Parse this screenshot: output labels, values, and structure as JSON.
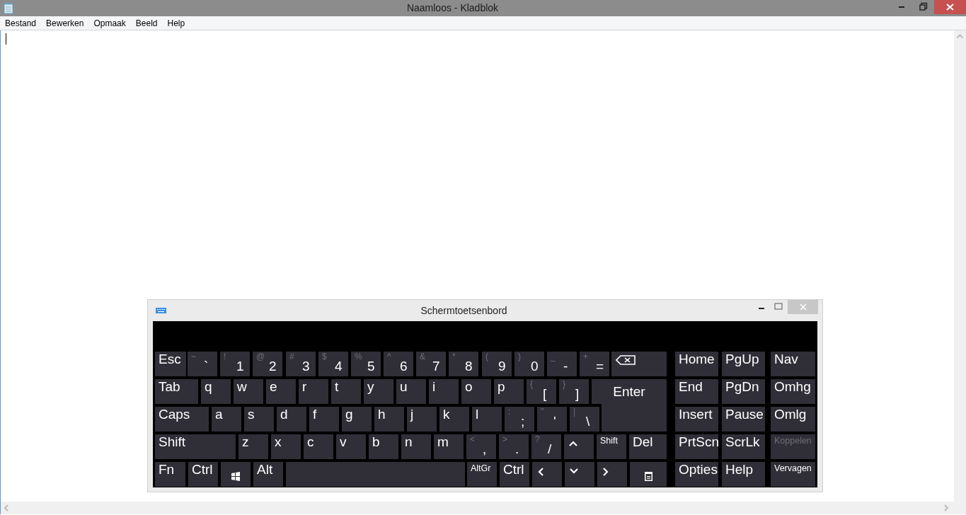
{
  "notepad": {
    "title": "Naamloos - Kladblok",
    "menu": [
      "Bestand",
      "Bewerken",
      "Opmaak",
      "Beeld",
      "Help"
    ]
  },
  "keyboard": {
    "title": "Schermtoetsenbord",
    "main_rows": [
      [
        {
          "kind": "text",
          "label": "Esc"
        },
        {
          "kind": "dual",
          "shift": "~",
          "label": "`"
        },
        {
          "kind": "dual",
          "shift": "!",
          "label": "1"
        },
        {
          "kind": "dual",
          "shift": "@",
          "label": "2"
        },
        {
          "kind": "dual",
          "shift": "#",
          "label": "3"
        },
        {
          "kind": "dual",
          "shift": "$",
          "label": "4"
        },
        {
          "kind": "dual",
          "shift": "%",
          "label": "5"
        },
        {
          "kind": "dual",
          "shift": "^",
          "label": "6"
        },
        {
          "kind": "dual",
          "shift": "&",
          "label": "7"
        },
        {
          "kind": "dual",
          "shift": "*",
          "label": "8"
        },
        {
          "kind": "dual",
          "shift": "(",
          "label": "9"
        },
        {
          "kind": "dual",
          "shift": ")",
          "label": "0"
        },
        {
          "kind": "dual",
          "shift": "_",
          "label": "-"
        },
        {
          "kind": "dual",
          "shift": "+",
          "label": "="
        },
        {
          "kind": "backspace"
        }
      ],
      [
        {
          "kind": "text",
          "label": "Tab"
        },
        {
          "kind": "text",
          "label": "q"
        },
        {
          "kind": "text",
          "label": "w"
        },
        {
          "kind": "text",
          "label": "e"
        },
        {
          "kind": "text",
          "label": "r"
        },
        {
          "kind": "text",
          "label": "t"
        },
        {
          "kind": "text",
          "label": "y"
        },
        {
          "kind": "text",
          "label": "u"
        },
        {
          "kind": "text",
          "label": "i"
        },
        {
          "kind": "text",
          "label": "o"
        },
        {
          "kind": "text",
          "label": "p"
        },
        {
          "kind": "dual",
          "shift": "{",
          "label": "["
        },
        {
          "kind": "dual",
          "shift": "}",
          "label": "]"
        },
        {
          "kind": "enter",
          "label": "Enter"
        }
      ],
      [
        {
          "kind": "text",
          "label": "Caps"
        },
        {
          "kind": "text",
          "label": "a"
        },
        {
          "kind": "text",
          "label": "s"
        },
        {
          "kind": "text",
          "label": "d"
        },
        {
          "kind": "text",
          "label": "f"
        },
        {
          "kind": "text",
          "label": "g"
        },
        {
          "kind": "text",
          "label": "h"
        },
        {
          "kind": "text",
          "label": "j"
        },
        {
          "kind": "text",
          "label": "k"
        },
        {
          "kind": "text",
          "label": "l"
        },
        {
          "kind": "dual",
          "shift": ":",
          "label": ";"
        },
        {
          "kind": "dual",
          "shift": "\"",
          "label": "'"
        },
        {
          "kind": "dual",
          "shift": "|",
          "label": "\\"
        }
      ],
      [
        {
          "kind": "text",
          "label": "Shift"
        },
        {
          "kind": "text",
          "label": "z"
        },
        {
          "kind": "text",
          "label": "x"
        },
        {
          "kind": "text",
          "label": "c"
        },
        {
          "kind": "text",
          "label": "v"
        },
        {
          "kind": "text",
          "label": "b"
        },
        {
          "kind": "text",
          "label": "n"
        },
        {
          "kind": "text",
          "label": "m"
        },
        {
          "kind": "dual",
          "shift": "<",
          "label": ","
        },
        {
          "kind": "dual",
          "shift": ">",
          "label": "."
        },
        {
          "kind": "dual",
          "shift": "?",
          "label": "/"
        },
        {
          "kind": "up"
        },
        {
          "kind": "small",
          "label": "Shift"
        },
        {
          "kind": "text",
          "label": "Del"
        }
      ],
      [
        {
          "kind": "text",
          "label": "Fn"
        },
        {
          "kind": "text",
          "label": "Ctrl"
        },
        {
          "kind": "windows"
        },
        {
          "kind": "text",
          "label": "Alt"
        },
        {
          "kind": "space"
        },
        {
          "kind": "small",
          "label": "AltGr"
        },
        {
          "kind": "text",
          "label": "Ctrl"
        },
        {
          "kind": "left"
        },
        {
          "kind": "down"
        },
        {
          "kind": "right"
        },
        {
          "kind": "menu"
        }
      ]
    ],
    "side_rows": [
      [
        {
          "kind": "text",
          "label": "Home",
          "disabled": false
        },
        {
          "kind": "text",
          "label": "PgUp",
          "disabled": false
        },
        {
          "kind": "text",
          "label": "Nav",
          "disabled": false
        }
      ],
      [
        {
          "kind": "text",
          "label": "End",
          "disabled": false
        },
        {
          "kind": "text",
          "label": "PgDn",
          "disabled": false
        },
        {
          "kind": "text",
          "label": "Omhg",
          "disabled": false
        }
      ],
      [
        {
          "kind": "text",
          "label": "Insert",
          "disabled": false
        },
        {
          "kind": "text",
          "label": "Pause",
          "disabled": false
        },
        {
          "kind": "text",
          "label": "Omlg",
          "disabled": false
        }
      ],
      [
        {
          "kind": "text",
          "label": "PrtScn",
          "disabled": false
        },
        {
          "kind": "text",
          "label": "ScrLk",
          "disabled": false
        },
        {
          "kind": "small",
          "label": "Koppelen",
          "disabled": true
        }
      ],
      [
        {
          "kind": "text",
          "label": "Opties",
          "disabled": false
        },
        {
          "kind": "text",
          "label": "Help",
          "disabled": false
        },
        {
          "kind": "small",
          "label": "Vervagen",
          "disabled": false
        }
      ]
    ]
  }
}
